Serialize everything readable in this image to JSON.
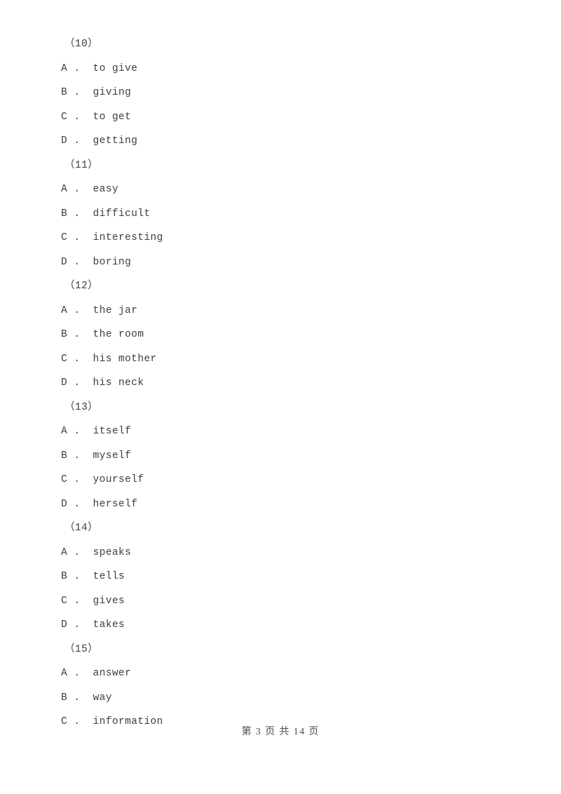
{
  "document": {
    "type": "exam-paper",
    "background_color": "#ffffff",
    "text_color": "#3d3d3d"
  },
  "questions": [
    {
      "number": "（10）",
      "options": [
        {
          "letter": "A",
          "separator": " .  ",
          "text": "to give"
        },
        {
          "letter": "B",
          "separator": " .  ",
          "text": "giving"
        },
        {
          "letter": "C",
          "separator": " .  ",
          "text": "to get"
        },
        {
          "letter": "D",
          "separator": " .  ",
          "text": "getting"
        }
      ]
    },
    {
      "number": "（11）",
      "options": [
        {
          "letter": "A",
          "separator": " .  ",
          "text": "easy"
        },
        {
          "letter": "B",
          "separator": " .  ",
          "text": "difficult"
        },
        {
          "letter": "C",
          "separator": " .  ",
          "text": "interesting"
        },
        {
          "letter": "D",
          "separator": " .  ",
          "text": "boring"
        }
      ]
    },
    {
      "number": "（12）",
      "options": [
        {
          "letter": "A",
          "separator": " .  ",
          "text": "the jar"
        },
        {
          "letter": "B",
          "separator": " .  ",
          "text": "the room"
        },
        {
          "letter": "C",
          "separator": " .  ",
          "text": "his mother"
        },
        {
          "letter": "D",
          "separator": " .  ",
          "text": "his neck"
        }
      ]
    },
    {
      "number": "（13）",
      "options": [
        {
          "letter": "A",
          "separator": " .  ",
          "text": "itself"
        },
        {
          "letter": "B",
          "separator": " .  ",
          "text": "myself"
        },
        {
          "letter": "C",
          "separator": " .  ",
          "text": "yourself"
        },
        {
          "letter": "D",
          "separator": " .  ",
          "text": "herself"
        }
      ]
    },
    {
      "number": "（14）",
      "options": [
        {
          "letter": "A",
          "separator": " .  ",
          "text": "speaks"
        },
        {
          "letter": "B",
          "separator": " .  ",
          "text": "tells"
        },
        {
          "letter": "C",
          "separator": " .  ",
          "text": "gives"
        },
        {
          "letter": "D",
          "separator": " .  ",
          "text": "takes"
        }
      ]
    },
    {
      "number": "（15）",
      "options": [
        {
          "letter": "A",
          "separator": " .  ",
          "text": "answer"
        },
        {
          "letter": "B",
          "separator": " .  ",
          "text": "way"
        },
        {
          "letter": "C",
          "separator": " .  ",
          "text": "information"
        }
      ]
    }
  ],
  "footer": {
    "text": "第 3 页 共 14 页",
    "current_page": "3",
    "total_pages": "14"
  }
}
